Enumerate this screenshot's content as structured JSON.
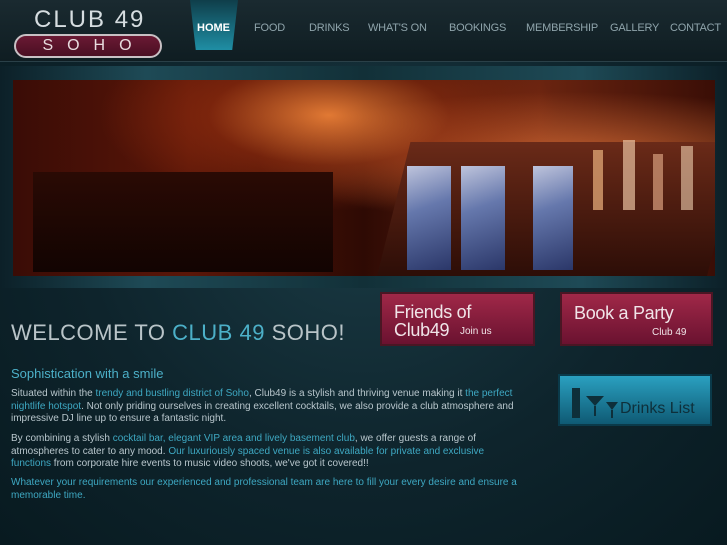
{
  "logo": {
    "line1": "CLUB 49",
    "line2": "SOHO"
  },
  "nav": {
    "items": [
      {
        "label": "HOME",
        "active": true
      },
      {
        "label": "FOOD"
      },
      {
        "label": "DRINKS"
      },
      {
        "label": "WHAT'S ON"
      },
      {
        "label": "BOOKINGS"
      },
      {
        "label": "MEMBERSHIP"
      },
      {
        "label": "GALLERY"
      },
      {
        "label": "CONTACT"
      }
    ]
  },
  "main": {
    "heading_pre": "WELCOME TO",
    "heading_hl": "CLUB 49",
    "heading_post": "SOHO!",
    "subtitle": "Sophistication with a smile",
    "p1": {
      "a": "Situated within the ",
      "link1": "trendy and bustling district of Soho",
      "b": ", Club49 is a stylish and thriving venue making it ",
      "link2": "the perfect nightlife hotspot",
      "c": ". Not only priding ourselves in creating excellent cocktails, we also provide a club atmosphere and impressive DJ line up to ensure a fantastic night."
    },
    "p2": {
      "a": "By combining a stylish ",
      "link1": "cocktail bar, elegant VIP area and lively basement club",
      "b": ", we offer guests a range of atmospheres to cater to any mood. ",
      "link2": "Our luxuriously spaced venue is also available for private and exclusive functions",
      "c": " from corporate hire events to music video shoots, we've got it covered!!"
    },
    "p3": "Whatever your requirements our experienced and professional team are here to fill your every desire and ensure a memorable time."
  },
  "promos": {
    "friends": {
      "line1": "Friends of",
      "line2": "Club49",
      "sub": "Join us"
    },
    "party": {
      "line1": "Book a Party",
      "sub": "Club 49"
    },
    "drinks": {
      "label": "Drinks List"
    }
  },
  "colors": {
    "accent": "#4cb0c8",
    "promo": "#a02848",
    "background": "#0e242c"
  }
}
